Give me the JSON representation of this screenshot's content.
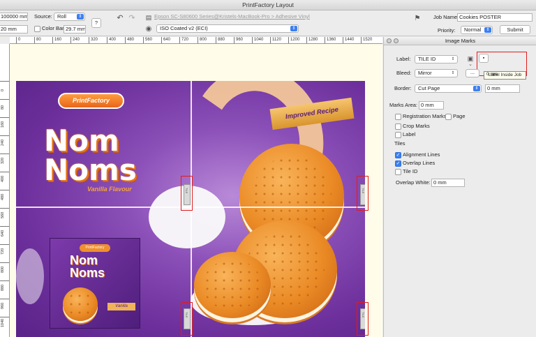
{
  "window": {
    "title": "PrintFactory Layout"
  },
  "toolbar": {
    "width_value": "100000 mm",
    "source_label": "Source:",
    "source_value": "Roll",
    "height_value": "20 mm",
    "color_bars_label": "Color Bars",
    "color_bars_value": "29.7 mm",
    "help_label": "?",
    "printer_path": "Epson SC-S80600 Series@Kristels-MacBook-Pro > Adhesive Vinyl",
    "profile_value": "ISO Coated v2 (ECI)",
    "job_name_label": "Job Name:",
    "job_name_value": "Cookies POSTER",
    "priority_label": "Priority:",
    "priority_value": "Normal",
    "submit_label": "Submit"
  },
  "ruler_top": [
    "0",
    "80",
    "160",
    "240",
    "320",
    "400",
    "480",
    "560",
    "640",
    "720",
    "800",
    "880",
    "960",
    "1040",
    "1120",
    "1200",
    "1280",
    "1360",
    "1440",
    "1520"
  ],
  "ruler_left": [
    "0",
    "80",
    "160",
    "240",
    "320",
    "400",
    "480",
    "560",
    "640",
    "720",
    "800",
    "880",
    "960",
    "1040"
  ],
  "artwork": {
    "brand": "PrintFactory",
    "title_line1": "Nom",
    "title_line2": "Noms",
    "flavor": "Vanilla Flavour",
    "tagline": "Improved Recipe",
    "pack_brand": "PrintFactory",
    "pack_line1": "Nom",
    "pack_line2": "Noms",
    "pack_flavor": "Vanilla",
    "tile_tag": "TILE"
  },
  "panel": {
    "title": "Image Marks",
    "label_label": "Label:",
    "label_value": "TILE ID",
    "bleed_label": "Bleed:",
    "bleed_value": "Mirror",
    "ellipsis_button": "...",
    "bleed_mm": "0 mm",
    "tooltip": "Label Inside Job",
    "border_label": "Border:",
    "border_value": "Cut Page",
    "border_mm": "0 mm",
    "marks_area_label": "Marks Area:",
    "marks_area_value": "0 mm",
    "registration_marks": "Registration Marks",
    "page": "Page",
    "crop_marks": "Crop Marks",
    "label_check": "Label",
    "tiles_heading": "Tiles",
    "alignment_lines": "Alignment Lines",
    "overlap_lines": "Overlap Lines",
    "tile_id": "Tile ID",
    "overlap_white_label": "Overlap White:",
    "overlap_white_value": "0 mm"
  }
}
